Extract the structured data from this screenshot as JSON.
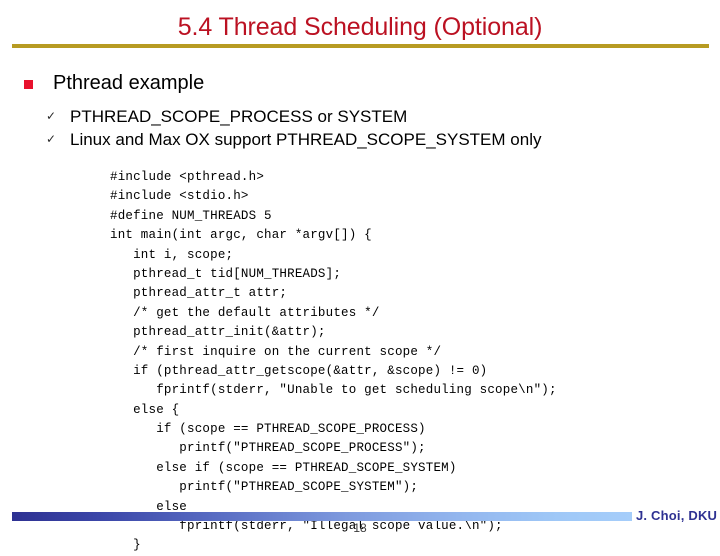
{
  "slide": {
    "title": "5.4 Thread Scheduling (Optional)",
    "title_color": "#bb1122",
    "rule_color": "#b79b22"
  },
  "content": {
    "bullet_l1": {
      "marker": "square-bullet",
      "marker_color": "#e8112d",
      "text": "Pthread example"
    },
    "bullets_l2": [
      {
        "marker": "✓",
        "text": "PTHREAD_SCOPE_PROCESS or SYSTEM"
      },
      {
        "marker": "✓",
        "text": "Linux and Max OX support PTHREAD_SCOPE_SYSTEM only"
      }
    ]
  },
  "code": {
    "language": "c",
    "lines": [
      "#include <pthread.h>",
      "#include <stdio.h>",
      "#define NUM_THREADS 5",
      "int main(int argc, char *argv[]) {",
      "   int i, scope;",
      "   pthread_t tid[NUM_THREADS];",
      "   pthread_attr_t attr;",
      "   /* get the default attributes */",
      "   pthread_attr_init(&attr);",
      "   /* first inquire on the current scope */",
      "   if (pthread_attr_getscope(&attr, &scope) != 0)",
      "      fprintf(stderr, \"Unable to get scheduling scope\\n\");",
      "   else {",
      "      if (scope == PTHREAD_SCOPE_PROCESS)",
      "         printf(\"PTHREAD_SCOPE_PROCESS\");",
      "      else if (scope == PTHREAD_SCOPE_SYSTEM)",
      "         printf(\"PTHREAD_SCOPE_SYSTEM\");",
      "      else",
      "         fprintf(stderr, \"Illegal scope value.\\n\");",
      "   }"
    ]
  },
  "footer": {
    "credit": "J. Choi, DKU",
    "credit_color": "#2e3192",
    "page_number": "18",
    "bar_start_color": "#2e3192",
    "bar_end_color": "#a5cdfa"
  }
}
